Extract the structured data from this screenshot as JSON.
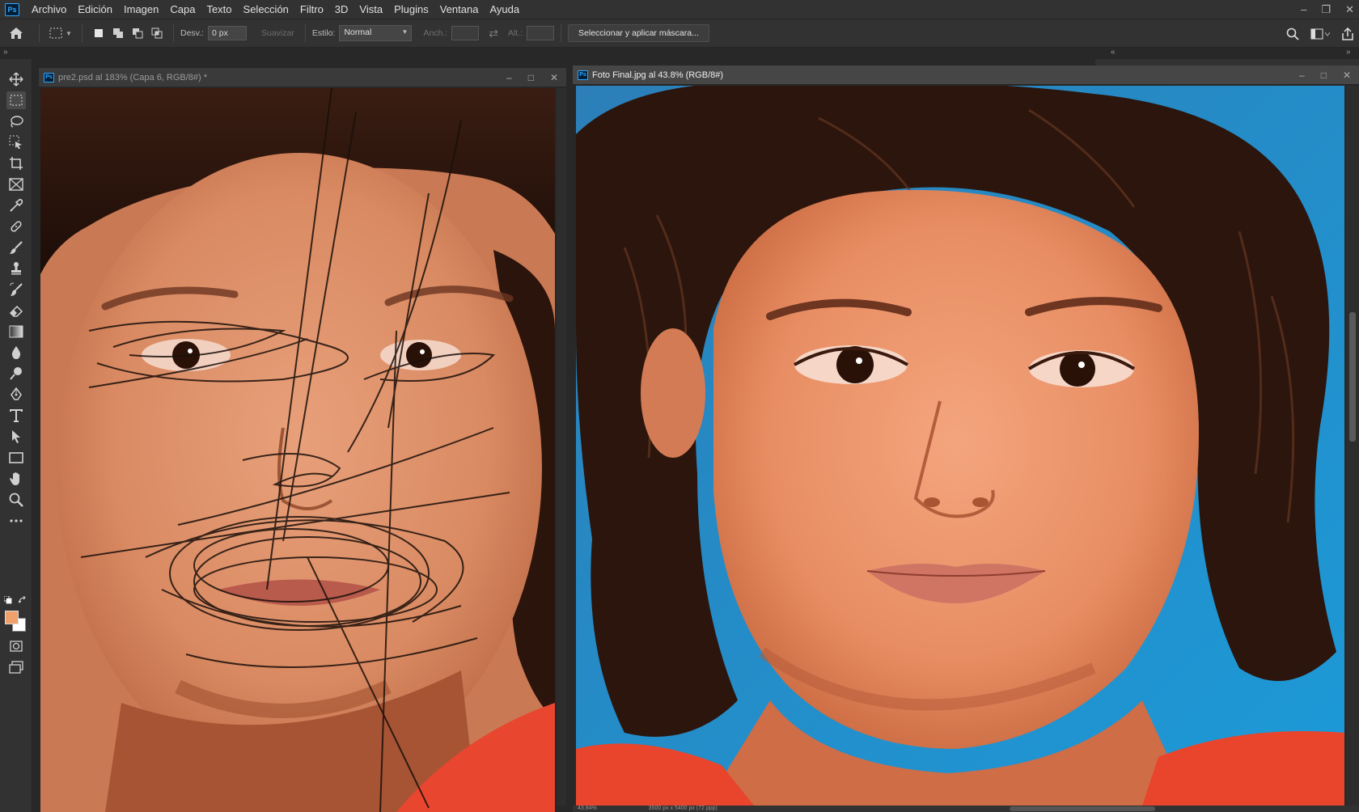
{
  "app": {
    "logo": "Ps",
    "menu": [
      "Archivo",
      "Edición",
      "Imagen",
      "Capa",
      "Texto",
      "Selección",
      "Filtro",
      "3D",
      "Vista",
      "Plugins",
      "Ventana",
      "Ayuda"
    ],
    "window_controls": [
      "minimize-icon",
      "restore-icon",
      "close-icon"
    ]
  },
  "options": {
    "feather_label": "Desv.:",
    "feather_value": "0 px",
    "antialias_label": "Suavizar",
    "style_label": "Estilo:",
    "style_value": "Normal",
    "width_label": "Anch.:",
    "height_label": "Alt.:",
    "mask_button": "Seleccionar y aplicar máscara..."
  },
  "tools": [
    "move-tool-icon",
    "rectangular-marquee-icon",
    "lasso-icon",
    "object-selection-icon",
    "crop-icon",
    "frame-icon",
    "eyedropper-icon",
    "healing-brush-icon",
    "brush-icon",
    "clone-stamp-icon",
    "history-brush-icon",
    "eraser-icon",
    "gradient-icon",
    "blur-icon",
    "dodge-icon",
    "pen-icon",
    "type-icon",
    "path-selection-icon",
    "rectangle-icon",
    "hand-icon",
    "zoom-icon",
    "more-tools-icon"
  ],
  "colors": {
    "foreground": "#f0a06a",
    "background": "#ffffff",
    "accent": "#31a8ff"
  },
  "documents": [
    {
      "title": "pre2.psd al 183% (Capa 6, RGB/8#) *",
      "active": false,
      "image": "Original photo of a child with pen scribbles over the face"
    },
    {
      "title": "Foto Final.jpg al 43.8% (RGB/8#)",
      "active": true,
      "image": "Restored photo of the child, scribbles removed",
      "status_zoom": "43.84%",
      "status_info": "3500 px x 5400 px (72 ppp)"
    }
  ]
}
